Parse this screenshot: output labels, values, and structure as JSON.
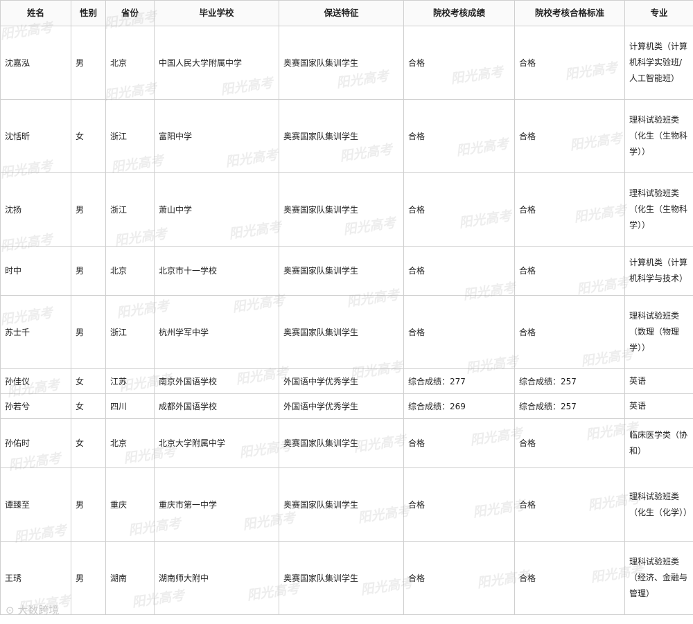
{
  "headers": [
    "姓名",
    "性别",
    "省份",
    "毕业学校",
    "保送特征",
    "院校考核成绩",
    "院校考核合格标准",
    "专业"
  ],
  "rows": [
    {
      "name": "沈嘉泓",
      "gender": "男",
      "province": "北京",
      "school": "中国人民大学附属中学",
      "feature": "奥赛国家队集训学生",
      "score": "合格",
      "standard": "合格",
      "major": "计算机类（计算机科学实验班/人工智能班）"
    },
    {
      "name": "沈恬昕",
      "gender": "女",
      "province": "浙江",
      "school": "富阳中学",
      "feature": "奥赛国家队集训学生",
      "score": "合格",
      "standard": "合格",
      "major": "理科试验班类（化生（生物科学））"
    },
    {
      "name": "沈扬",
      "gender": "男",
      "province": "浙江",
      "school": "萧山中学",
      "feature": "奥赛国家队集训学生",
      "score": "合格",
      "standard": "合格",
      "major": "理科试验班类（化生（生物科学））"
    },
    {
      "name": "时中",
      "gender": "男",
      "province": "北京",
      "school": "北京市十一学校",
      "feature": "奥赛国家队集训学生",
      "score": "合格",
      "standard": "合格",
      "major": "计算机类（计算机科学与技术）"
    },
    {
      "name": "苏士千",
      "gender": "男",
      "province": "浙江",
      "school": "杭州学军中学",
      "feature": "奥赛国家队集训学生",
      "score": "合格",
      "standard": "合格",
      "major": "理科试验班类（数理（物理学））"
    },
    {
      "name": "孙佳仪",
      "gender": "女",
      "province": "江苏",
      "school": "南京外国语学校",
      "feature": "外国语中学优秀学生",
      "score": "综合成绩：277",
      "standard": "综合成绩：257",
      "major": "英语"
    },
    {
      "name": "孙若兮",
      "gender": "女",
      "province": "四川",
      "school": "成都外国语学校",
      "feature": "外国语中学优秀学生",
      "score": "综合成绩：269",
      "standard": "综合成绩：257",
      "major": "英语"
    },
    {
      "name": "孙佑时",
      "gender": "女",
      "province": "北京",
      "school": "北京大学附属中学",
      "feature": "奥赛国家队集训学生",
      "score": "合格",
      "standard": "合格",
      "major": "临床医学类（协和）"
    },
    {
      "name": "谭臻至",
      "gender": "男",
      "province": "重庆",
      "school": "重庆市第一中学",
      "feature": "奥赛国家队集训学生",
      "score": "合格",
      "standard": "合格",
      "major": "理科试验班类（化生（化学））"
    },
    {
      "name": "王琇",
      "gender": "男",
      "province": "湖南",
      "school": "湖南师大附中",
      "feature": "奥赛国家队集训学生",
      "score": "合格",
      "standard": "合格",
      "major": "理科试验班类（经济、金融与管理）"
    }
  ],
  "watermark_text": "阳光高考",
  "footer_logo": "大数跨境"
}
